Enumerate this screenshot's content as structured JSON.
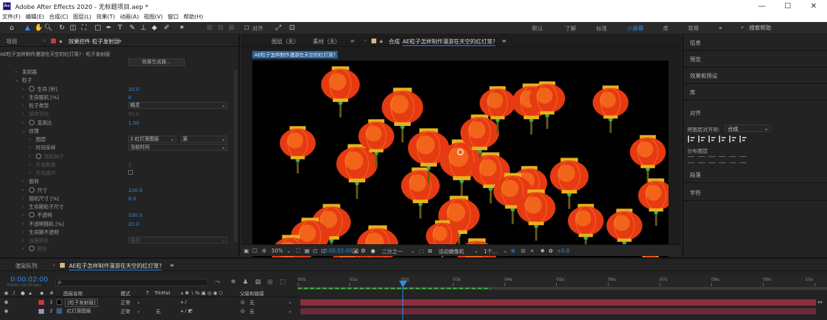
{
  "titlebar": {
    "title": "Adobe After Effects 2020 - 无标题项目.aep *",
    "logo": "Ae",
    "minimize": "—",
    "maximize": "☐",
    "close": "✕"
  },
  "menu": [
    "文件(F)",
    "编辑(E)",
    "合成(C)",
    "图层(L)",
    "效果(T)",
    "动画(A)",
    "视图(V)",
    "窗口",
    "帮助(H)"
  ],
  "toolbar": {
    "snap_label": "对齐",
    "workspaces": [
      "默认",
      "了解",
      "标准",
      "小屏幕",
      "库",
      "常用"
    ],
    "active_workspace": "小屏幕",
    "more": "»",
    "search_placeholder": "搜索帮助"
  },
  "left": {
    "tab_project": "项目",
    "tab_effects": "效果控件 粒子发射层",
    "breadcrumb": "AE粒子怎样制作漫游在天空的红灯笼? · 粒子发射层",
    "gen_button": "效果生成器...",
    "rows": [
      {
        "label": "发射器",
        "indent": 1
      },
      {
        "label": "粒子",
        "indent": 1,
        "open": true
      },
      {
        "label": "生命 [秒]",
        "indent": 2,
        "sw": true,
        "value": "10.0"
      },
      {
        "label": "生命随机 [%]",
        "indent": 2,
        "value": "0"
      },
      {
        "label": "粒子类型",
        "indent": 2,
        "dd": "精灵"
      },
      {
        "label": "球体羽化",
        "indent": 2,
        "value": "50.0",
        "dim": true
      },
      {
        "label": "宽高比",
        "indent": 2,
        "sw": true,
        "value": "1.00"
      },
      {
        "label": "纹理",
        "indent": 2,
        "open": true
      },
      {
        "label": "图层",
        "indent": 3,
        "dd": "2.红灯笼图层",
        "dd2": "源"
      },
      {
        "label": "时间采样",
        "indent": 3,
        "dd": "当前时间"
      },
      {
        "label": "随机种子",
        "indent": 3,
        "sw": true,
        "dim": true,
        "value": ""
      },
      {
        "label": "片段数量",
        "indent": 3,
        "dim": true,
        "value": "1"
      },
      {
        "label": "片段循环",
        "indent": 3,
        "dim": true,
        "check": true
      },
      {
        "label": "旋转",
        "indent": 2
      },
      {
        "label": "尺寸",
        "indent": 2,
        "sw": true,
        "value": "100.0"
      },
      {
        "label": "随机尺寸 [%]",
        "indent": 2,
        "value": "0.0"
      },
      {
        "label": "生命期粒子尺寸",
        "indent": 2
      },
      {
        "label": "不透明",
        "indent": 2,
        "sw": true,
        "value": "100.0"
      },
      {
        "label": "不透明随机 [%]",
        "indent": 2,
        "value": "20.0"
      },
      {
        "label": "生命期不透明",
        "indent": 2
      },
      {
        "label": "设置颜色",
        "indent": 2,
        "dim": true,
        "dd": "自由"
      },
      {
        "label": "颜色",
        "indent": 2,
        "sw": true,
        "dim": true
      }
    ]
  },
  "viewer": {
    "tab_layer": "图层（无）",
    "tab_footage": "素材（无）",
    "tab_comp_prefix": "合成",
    "tab_comp": "AE粒子怎样制作漫游在天空的红灯笼?",
    "comp_label": "AE粒子怎样制作漫游在天空的红灯笼?",
    "zoom": "50%",
    "timecode": "0:00:02:00",
    "resolution": "二分之一",
    "camera": "活动摄像机",
    "views": "1个...",
    "exposure": "+0.0"
  },
  "right": {
    "sections": [
      "信息",
      "预览",
      "效果和预设",
      "库",
      "对齐",
      "段落",
      "字符"
    ],
    "align_to_label": "将图层对齐到:",
    "align_to_value": "合成",
    "distribute_label": "分布图层"
  },
  "timeline": {
    "tab_render": "渲染队列",
    "tab_comp": "AE粒子怎样制作漫游在天空的红灯笼?",
    "timecode": "0:00:02:00",
    "frame_info": "00060 (30.00 fps)",
    "search_placeholder": "ρ.",
    "col_index": "#",
    "col_name": "图层名称",
    "col_mode": "模式",
    "col_t": "T",
    "col_trkmat": "TrkMat",
    "col_parent": "父级和链接",
    "ticks": [
      "00s",
      "01s",
      "02s",
      "03s",
      "04s",
      "05s",
      "06s",
      "07s",
      "08s",
      "09s",
      "10s"
    ],
    "layers": [
      {
        "index": "1",
        "name": "[粒子发射层]",
        "mode": "正常",
        "trkmat": "",
        "parent": "无",
        "color": "#c43c3c"
      },
      {
        "index": "2",
        "name": "红灯笼图层",
        "mode": "正常",
        "trkmat": "无",
        "parent": "无",
        "color": "#9a8fc0"
      }
    ]
  },
  "colors": {
    "accent": "#2d8ceb",
    "lantern": "#e63a12",
    "bar": "#7d2c3a"
  }
}
